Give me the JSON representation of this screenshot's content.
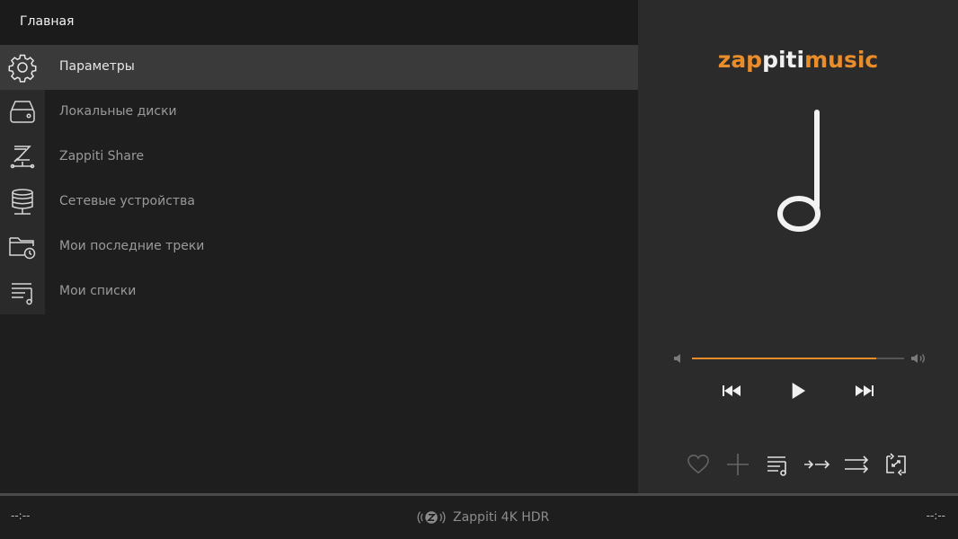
{
  "header": {
    "title": "Главная"
  },
  "menu": {
    "items": [
      {
        "label": "Параметры",
        "icon": "gear-icon",
        "selected": true
      },
      {
        "label": "Локальные диски",
        "icon": "hard-drive-icon",
        "selected": false
      },
      {
        "label": "Zappiti Share",
        "icon": "zappiti-share-icon",
        "selected": false
      },
      {
        "label": "Сетевые устройства",
        "icon": "network-storage-icon",
        "selected": false
      },
      {
        "label": "Мои последние треки",
        "icon": "recent-folder-icon",
        "selected": false
      },
      {
        "label": "Мои списки",
        "icon": "playlist-icon",
        "selected": false
      }
    ]
  },
  "player": {
    "logo": {
      "part1": "zap",
      "part2": "piti",
      "part3": "music"
    },
    "artwork_icon": "music-note-icon",
    "volume": {
      "level": 0.87
    },
    "transport": [
      "previous-icon",
      "play-icon",
      "next-icon"
    ],
    "actions": [
      "heart-icon",
      "plus-icon",
      "queue-icon",
      "shuffle-icon",
      "repeat-icon",
      "repeat-one-icon"
    ]
  },
  "status": {
    "elapsed": "--:--",
    "remaining": "--:--",
    "device": "Zappiti 4K HDR",
    "device_icon": "zappiti-wireless-icon"
  },
  "colors": {
    "accent": "#e98c2a",
    "background": "#1e1e1f",
    "panel": "#2b2b2c",
    "selected": "#3a3a3b"
  }
}
